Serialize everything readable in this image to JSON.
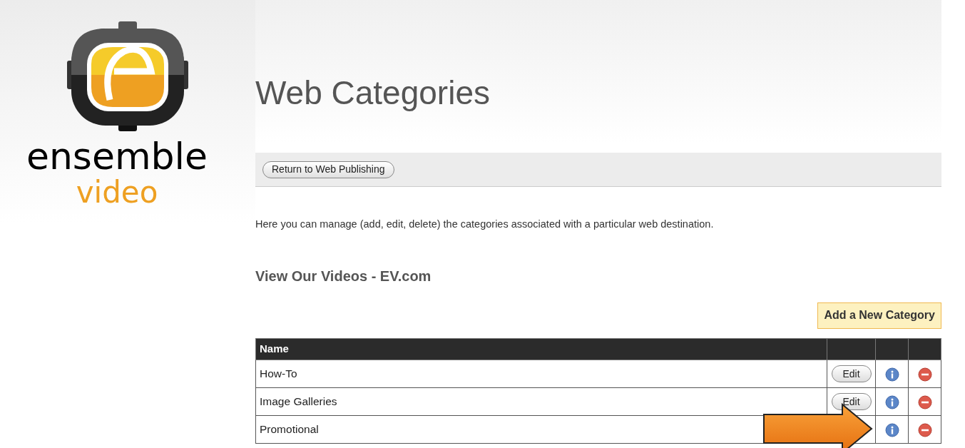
{
  "logo": {
    "word": "ensemble",
    "tagline": "video"
  },
  "title": "Web Categories",
  "toolbar": {
    "button": "Return to Web Publishing"
  },
  "intro": "Here you can manage (add, edit, delete) the categories associated with a particular web destination.",
  "destination": "View Our Videos - EV.com",
  "add_button": "Add a New Category",
  "table": {
    "columns": [
      "Name"
    ],
    "rows": [
      {
        "name": "How-To",
        "edit": "Edit"
      },
      {
        "name": "Image Galleries",
        "edit": "Edit"
      },
      {
        "name": "Promotional",
        "arrow": true
      }
    ]
  }
}
